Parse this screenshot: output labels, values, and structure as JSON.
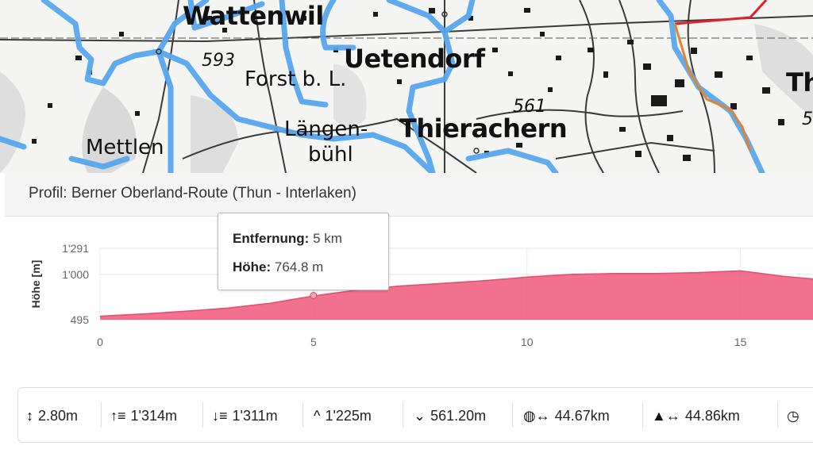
{
  "map": {
    "labels": {
      "wattenwil": "Wattenwil",
      "uetendorf": "Uetendorf",
      "forst": "Forst b. L.",
      "laengen": "Längen-",
      "buehl": "bühl",
      "thierachern": "Thierachern",
      "mettlen": "Mettlen",
      "th": "Th",
      "elev593": "593",
      "elev561": "561",
      "elev5": "5"
    }
  },
  "profile": {
    "title": "Profil: Berner Oberland-Route (Thun - Interlaken)"
  },
  "tooltip": {
    "distance_label": "Entfernung:",
    "distance_value": "5 km",
    "height_label": "Höhe:",
    "height_value": "764.8 m"
  },
  "chart_data": {
    "type": "area",
    "ylabel": "Höhe [m]",
    "y_ticks": [
      "1'291",
      "1'000",
      "495"
    ],
    "y_tick_values": [
      1291,
      1000,
      495
    ],
    "x_ticks": [
      "0",
      "5",
      "10",
      "15"
    ],
    "x_tick_values": [
      0,
      5,
      10,
      15
    ],
    "xlim": [
      0,
      16.7
    ],
    "ylim": [
      495,
      1291
    ],
    "x": [
      0,
      1,
      2,
      3,
      4,
      5,
      6,
      7,
      8,
      9,
      10,
      11,
      12,
      13,
      14,
      15,
      15.5,
      16,
      16.7
    ],
    "y": [
      534,
      560,
      590,
      625,
      680,
      760,
      825,
      870,
      900,
      930,
      970,
      1000,
      1010,
      1010,
      1020,
      1040,
      1010,
      980,
      950
    ],
    "highlight_x": 5,
    "highlight_y": 764.8,
    "color": "#f0587a",
    "grid": true
  },
  "stats": [
    {
      "icon": "vertical-arrows-icon",
      "value": "2.80m"
    },
    {
      "icon": "sort-ascending-icon",
      "value": "1'314m"
    },
    {
      "icon": "sort-descending-icon",
      "value": "1'311m"
    },
    {
      "icon": "caret-up-icon",
      "value": "1'225m"
    },
    {
      "icon": "caret-down-icon",
      "value": "561.20m"
    },
    {
      "icon": "globe-distance-icon",
      "value": "44.67km"
    },
    {
      "icon": "mountain-distance-icon",
      "value": "44.86km"
    },
    {
      "icon": "clock-icon",
      "value": ""
    }
  ],
  "colors": {
    "route_blue": "#58a6ee",
    "track_red": "#e0202c",
    "track_orange": "#e8822a",
    "elevation_fill": "#f0587a"
  }
}
